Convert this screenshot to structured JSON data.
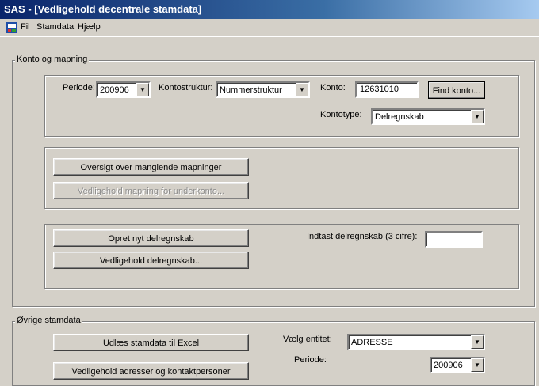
{
  "window": {
    "title": "SAS - [Vedligehold decentrale stamdata]"
  },
  "menu": {
    "items": [
      "Fil",
      "Stamdata",
      "Hjælp"
    ]
  },
  "konto_group": {
    "label": "Konto og mapning",
    "periode_label": "Periode:",
    "periode_value": "200906",
    "kontostruktur_label": "Kontostruktur:",
    "kontostruktur_value": "Nummerstruktur",
    "konto_label": "Konto:",
    "konto_value": "12631010",
    "find_konto_button": "Find konto...",
    "kontotype_label": "Kontotype:",
    "kontotype_value": "Delregnskab"
  },
  "mapning_panel": {
    "oversigt_button": "Oversigt over manglende mapninger",
    "vedligehold_mapning_button": "Vedligehold mapning for underkonto..."
  },
  "delregnskab_panel": {
    "opret_button": "Opret nyt delregnskab",
    "vedligehold_button": "Vedligehold delregnskab...",
    "indtast_label": "Indtast delregnskab (3 cifre):",
    "indtast_value": ""
  },
  "ovrige_group": {
    "label": "Øvrige stamdata",
    "udlaes_button": "Udlæs stamdata til Excel",
    "vedligehold_adresser_button": "Vedligehold adresser og kontaktpersoner",
    "vaelg_entitet_label": "Vælg entitet:",
    "vaelg_entitet_value": "ADRESSE",
    "periode_label": "Periode:",
    "periode_value": "200906"
  }
}
